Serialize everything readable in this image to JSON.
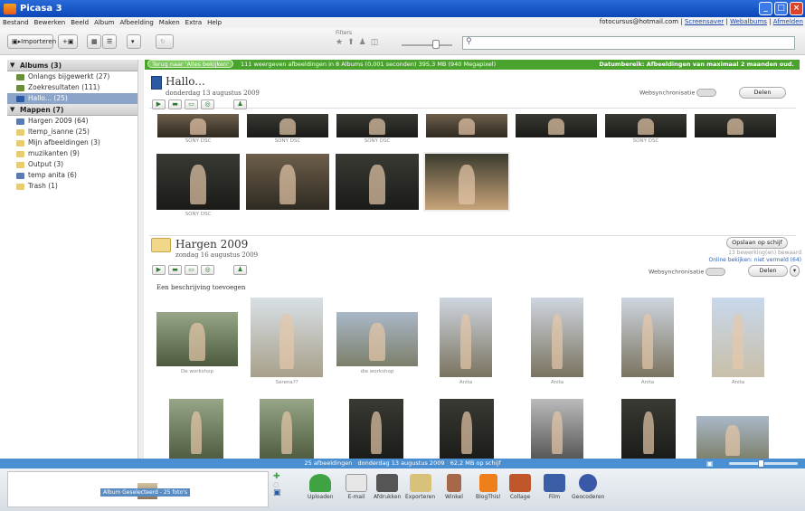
{
  "window": {
    "title": "Picasa 3"
  },
  "menu": {
    "items": [
      "Bestand",
      "Bewerken",
      "Beeld",
      "Album",
      "Afbeelding",
      "Maken",
      "Extra",
      "Help"
    ],
    "account": "fotocursus@hotmail.com",
    "links": [
      "Screensaver",
      "Webalbums",
      "Afmelden"
    ]
  },
  "toolbar": {
    "import_label": "Importeren",
    "filters_label": "Filters"
  },
  "sidebar": {
    "albums_header": "Albums (3)",
    "albums": [
      {
        "label": "Onlangs bijgewerkt (27)"
      },
      {
        "label": "Zoekresultaten (111)"
      },
      {
        "label": "Hallo... (25)",
        "selected": true
      }
    ],
    "folders_header": "Mappen (7)",
    "folders": [
      {
        "label": "Hargen 2009 (64)"
      },
      {
        "label": "ltemp_isanne (25)"
      },
      {
        "label": "Mijn afbeeldingen (3)"
      },
      {
        "label": "muzikanten (9)"
      },
      {
        "label": "Output (3)"
      },
      {
        "label": "temp anita (6)"
      },
      {
        "label": "Trash (1)"
      }
    ]
  },
  "greenbar": {
    "back_button": "Terug naar 'Alles bekijken'",
    "info": "111 weergeven afbeeldingen in 8 Albums (0,001 seconden) 395,3 MB (940 Megapixel)",
    "date_range": "Datumbereik: Afbeeldingen van maximaal 2 maanden oud."
  },
  "album": {
    "title": "Hallo...",
    "date": "donderdag 13 augustus 2009",
    "websync_label": "Websynchronisatie",
    "share_label": "Delen",
    "row1_captions": [
      "SONY DSC",
      "SONY DSC",
      "SONY DSC",
      "SONY DSC"
    ],
    "row2_captions": [
      "SONY DSC"
    ]
  },
  "hargen": {
    "title": "Hargen 2009",
    "date": "zondag 16 augustus 2009",
    "save_label": "Opslaan op schijf",
    "saved_info": "13 bewerking(en) bewaard",
    "online_info": "Online bekijken: niet vermeld (64)",
    "websync_label": "Websynchronisatie",
    "share_label": "Delen",
    "desc_placeholder": "Een beschrijving toevoegen",
    "captions": [
      "De workshop",
      "Serena??",
      "die workshop",
      "Anita",
      "Anita",
      "Anita",
      "Anita"
    ]
  },
  "status": {
    "count": "25 afbeeldingen",
    "date": "donderdag 13 augustus 2009",
    "size": "62,2 MB op schijf"
  },
  "tray": {
    "tooltip": "Album Geselecteerd - 25 foto's"
  },
  "bottom_tools": [
    {
      "label": "Uploaden",
      "color": "#3fa343"
    },
    {
      "label": "E-mail",
      "color": "#cfcfcf"
    },
    {
      "label": "Afdrukken",
      "color": "#555555"
    },
    {
      "label": "Exporteren",
      "color": "#d8c27a"
    },
    {
      "label": "Winkel",
      "color": "#a7684a"
    },
    {
      "label": "BlogThis!",
      "color": "#ef7f1a"
    },
    {
      "label": "Collage",
      "color": "#c0572b"
    },
    {
      "label": "Film",
      "color": "#3b5fa6"
    },
    {
      "label": "Geocoderen",
      "color": "#3a58a8"
    }
  ]
}
